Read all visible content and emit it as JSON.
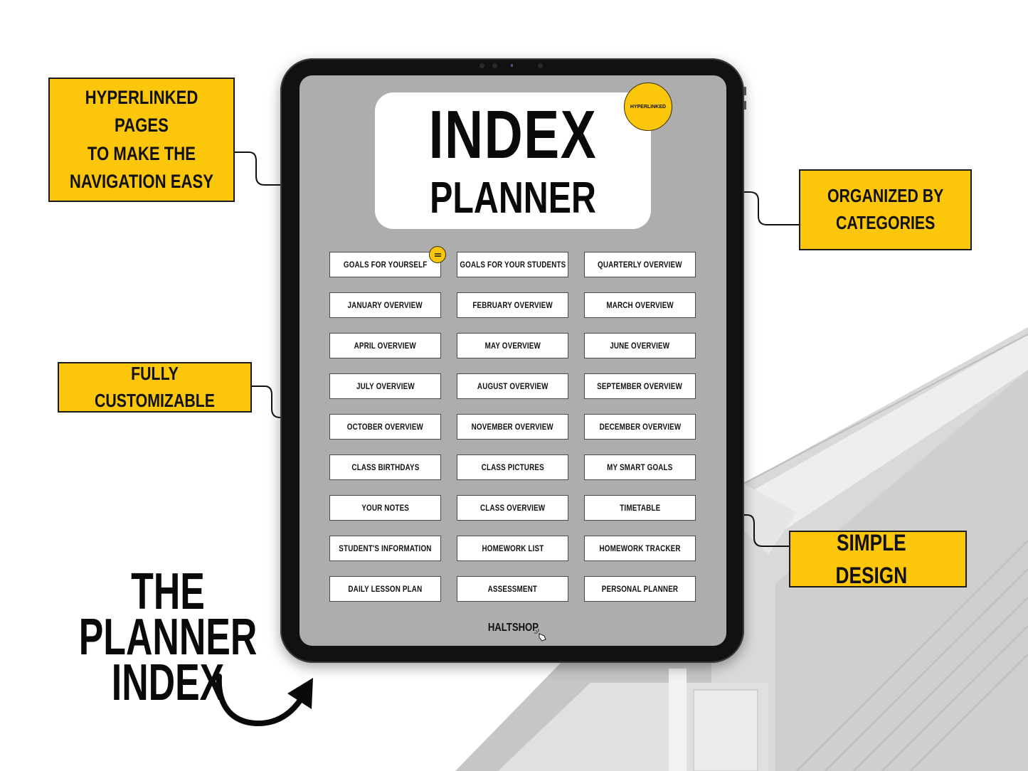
{
  "tablet": {
    "title": "INDEX",
    "subtitle": "PLANNER",
    "badge": "HYPERLINKED",
    "brand": "HALTSHOP",
    "index_items": [
      "Goals for yourself",
      "Goals for your students",
      "Quarterly overview",
      "January overview",
      "February overview",
      "March overview",
      "April overview",
      "May overview",
      "June overview",
      "July overview",
      "August overview",
      "September overview",
      "October overview",
      "November overview",
      "December overview",
      "Class birthdays",
      "Class pictures",
      "My smart goals",
      "Your notes",
      "Class overview",
      "Timetable",
      "Student's information",
      "Homework list",
      "Homework tracker",
      "Daily lesson plan",
      "Assessment",
      "Personal planner"
    ]
  },
  "callouts": {
    "hyperlinked": "HYPERLINKED PAGES\nTO MAKE THE\nNAVIGATION EASY",
    "organized": "ORGANIZED BY\nCATEGORIES",
    "customizable": "FULLY CUSTOMIZABLE",
    "simple": "SIMPLE DESIGN"
  },
  "headline": "THE\nPLANNER\nINDEX",
  "colors": {
    "accent_yellow": "#fcc60a",
    "screen_gray": "#adadad",
    "bezel": "#111111"
  }
}
